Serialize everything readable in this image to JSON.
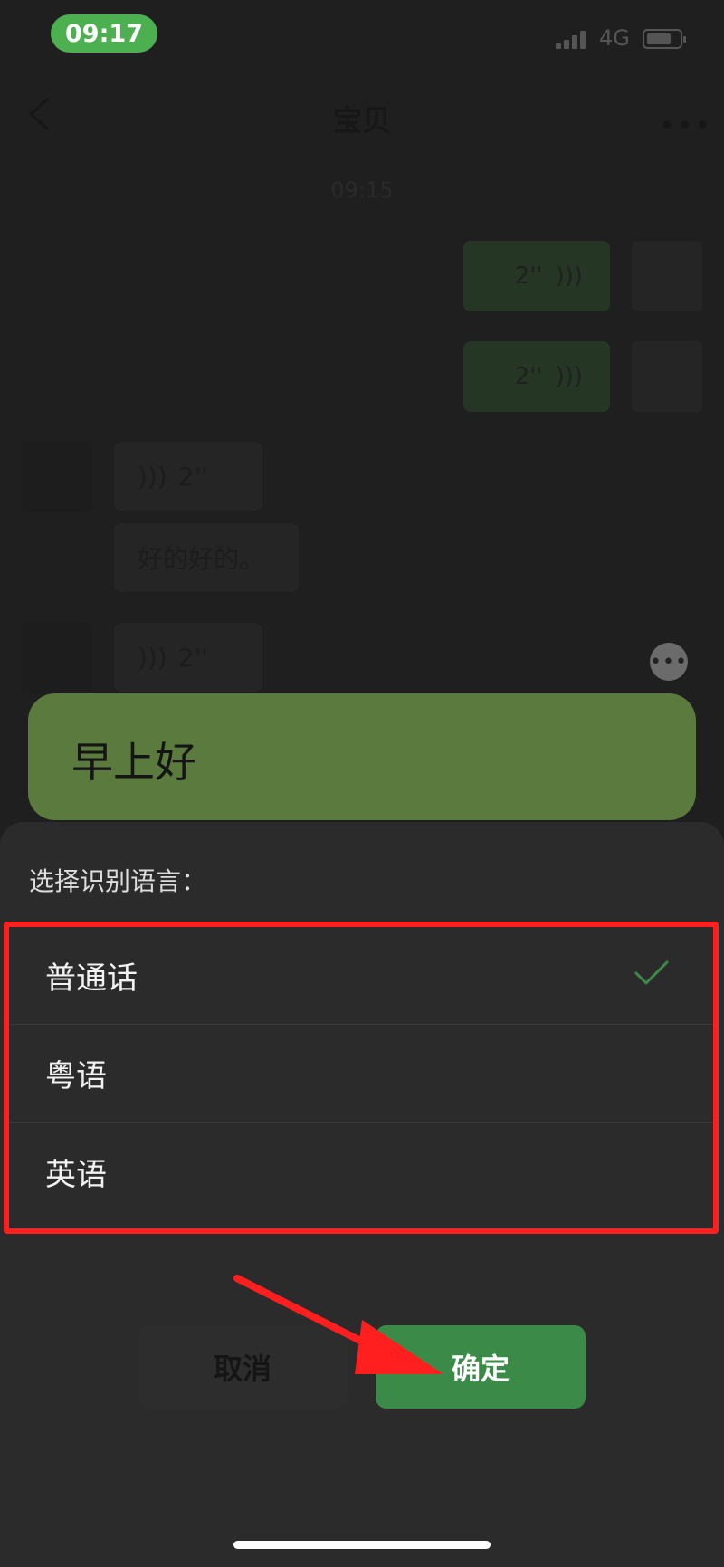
{
  "status_bar": {
    "time": "09:17",
    "network": "4G"
  },
  "chat": {
    "title": "宝贝",
    "timestamp": "09:15",
    "outgoing": [
      {
        "duration": "2''"
      },
      {
        "duration": "2''"
      }
    ],
    "incoming": [
      {
        "duration": "2''"
      },
      {
        "text": "好的好的。"
      },
      {
        "duration": "2''"
      }
    ]
  },
  "transcript": {
    "text": "早上好"
  },
  "language_sheet": {
    "title": "选择识别语言：",
    "options": [
      {
        "label": "普通话",
        "selected": true
      },
      {
        "label": "粤语",
        "selected": false
      },
      {
        "label": "英语",
        "selected": false
      }
    ],
    "cancel_label": "取消",
    "confirm_label": "确定"
  },
  "colors": {
    "accent": "#3c8a48",
    "highlight_border": "#ff1f1f",
    "annotation_arrow": "#ff1f1f"
  }
}
